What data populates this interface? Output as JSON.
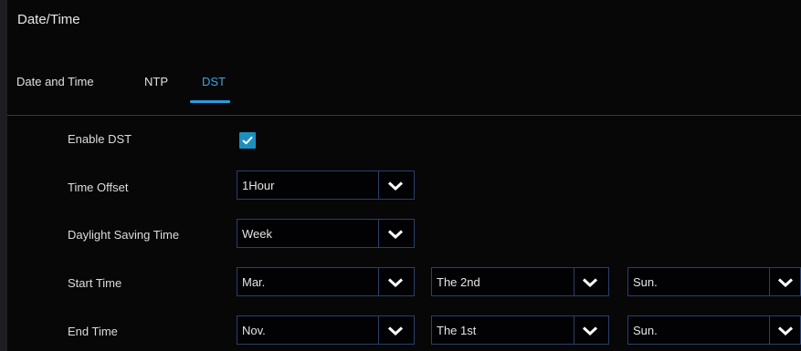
{
  "window": {
    "title": "Date/Time"
  },
  "tabs": [
    {
      "label": "Date and Time",
      "active": false
    },
    {
      "label": "NTP",
      "active": false
    },
    {
      "label": "DST",
      "active": true
    }
  ],
  "form": {
    "enable_dst": {
      "label": "Enable DST",
      "checked": true
    },
    "time_offset": {
      "label": "Time Offset",
      "value": "1Hour"
    },
    "daylight_saving_time": {
      "label": "Daylight Saving Time",
      "value": "Week"
    },
    "start_time": {
      "label": "Start Time",
      "month": "Mar.",
      "week": "The 2nd",
      "day": "Sun."
    },
    "end_time": {
      "label": "End Time",
      "month": "Nov.",
      "week": "The 1st",
      "day": "Sun."
    }
  },
  "colors": {
    "accent": "#2b9be2",
    "checkbox": "#1d8fbf",
    "field_border": "#2a3f6b",
    "background": "#070708"
  },
  "icons": {
    "checkbox": "check-icon",
    "dropdown": "chevron-down-icon"
  }
}
